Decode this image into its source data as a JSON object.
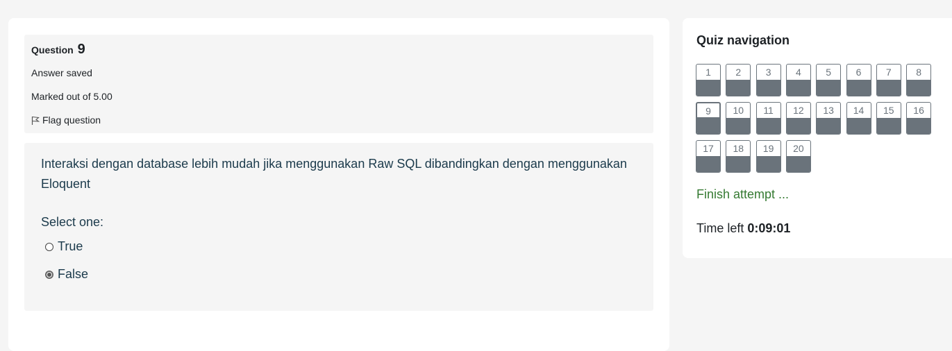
{
  "question": {
    "label": "Question",
    "number": "9",
    "state": "Answer saved",
    "marks": "Marked out of 5.00",
    "flag_label": "Flag question",
    "text": "Interaksi dengan database lebih mudah jika menggunakan Raw SQL dibandingkan dengan menggunakan Eloquent",
    "prompt": "Select one:",
    "options": [
      {
        "label": "True",
        "selected": false
      },
      {
        "label": "False",
        "selected": true
      }
    ]
  },
  "quiz_nav": {
    "title": "Quiz navigation",
    "current": 9,
    "buttons": [
      "1",
      "2",
      "3",
      "4",
      "5",
      "6",
      "7",
      "8",
      "9",
      "10",
      "11",
      "12",
      "13",
      "14",
      "15",
      "16",
      "17",
      "18",
      "19",
      "20"
    ],
    "finish_label": "Finish attempt ...",
    "time_label": "Time left",
    "time_value": "0:09:01"
  }
}
